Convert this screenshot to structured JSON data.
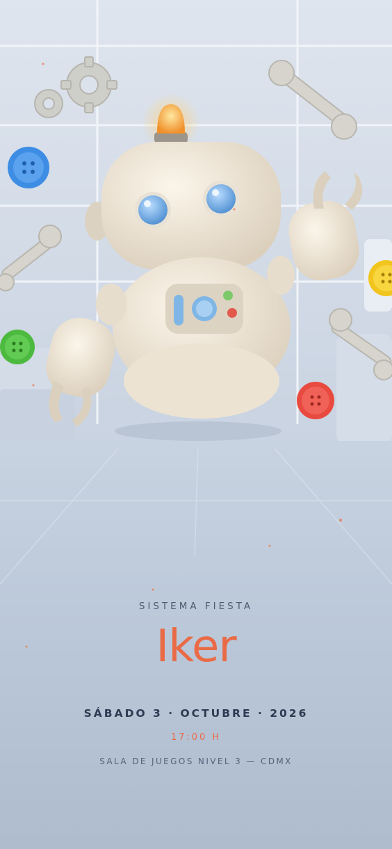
{
  "colors": {
    "accent": "#ea6a46",
    "text_dark": "#2e3a52",
    "text_muted": "#56627a",
    "background": "#b4c2d4"
  },
  "icons": [
    "gear-icon",
    "wrench-icon",
    "button-icon",
    "robot-illustration"
  ],
  "invitation": {
    "eyebrow": "SISTEMA FIESTA",
    "name": "Iker",
    "date": "SÁBADO 3 · OCTUBRE · 2026",
    "time": "17:00 H",
    "venue": "SALA DE JUEGOS NIVEL 3 — CDMX"
  }
}
